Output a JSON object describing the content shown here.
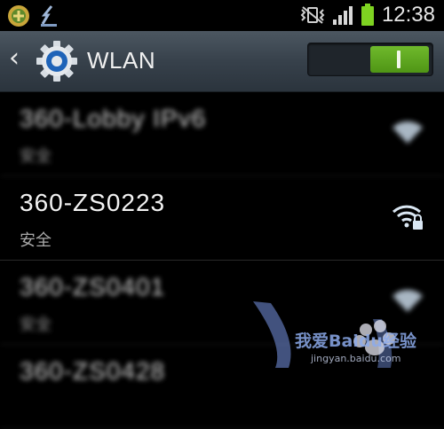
{
  "status_bar": {
    "time": "12:38",
    "icons": [
      "app-notification-icon",
      "download-icon",
      "vibrate-mode-icon",
      "signal-strength-icon",
      "battery-icon"
    ],
    "colors": {
      "battery": "#7ed321"
    }
  },
  "header": {
    "title": "WLAN",
    "back_icon": "back-chevron-icon",
    "settings_icon": "gear-icon",
    "toggle": {
      "state": "on",
      "label": "I",
      "on_color": "#5aa31e"
    }
  },
  "networks": [
    {
      "ssid": "360-Lobby IPv6",
      "security": "安全",
      "blurred": true
    },
    {
      "ssid": "360-ZS0223",
      "security": "安全",
      "blurred": false
    },
    {
      "ssid": "360-ZS0401",
      "security": "安全",
      "blurred": true
    },
    {
      "ssid": "360-ZS0428",
      "security": "",
      "blurred": true
    }
  ],
  "watermark": {
    "text": "我爱Baidu经验",
    "url": "jingyan.baidu.com"
  }
}
